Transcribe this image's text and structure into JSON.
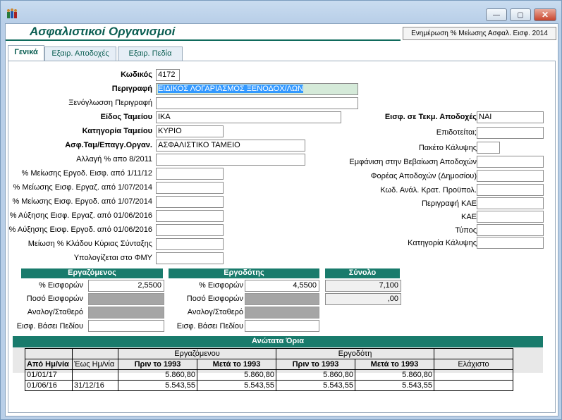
{
  "window": {
    "title_buttons": {
      "minimize": "—",
      "restore": "▢",
      "close": "✕"
    }
  },
  "header": {
    "title": "Ασφαλιστικοί Οργανισμοί",
    "update_label": "Ενημέρωση % Μείωσης  Ασφαλ. Εισφ. 2014"
  },
  "tabs": [
    {
      "label": "Γενικά"
    },
    {
      "label": "Εξαιρ. Αποδοχές"
    },
    {
      "label": "Εξαιρ. Πεδία"
    }
  ],
  "left": {
    "code": {
      "label": "Κωδικός",
      "value": "4172"
    },
    "description": {
      "label": "Περιγραφή",
      "value": "ΕΙΔΙΚΟΣ ΛΟΓΑΡΙΑΣΜΟΣ ΞΕΝΟΔΟΧ/ΛΩΝ"
    },
    "foreign_description": {
      "label": "Ξενόγλωσση Περιγραφή",
      "value": ""
    },
    "fund_type": {
      "label": "Είδος Ταμείου",
      "value": "ΙΚΑ"
    },
    "fund_category": {
      "label": "Κατηγορία Ταμείου",
      "value": "ΚΥΡΙΟ"
    },
    "insurance_org": {
      "label": "Ασφ.Ταμ/Επαγγ.Οργαν.",
      "value": "ΑΣΦΑΛΙΣΤΙΚΟ ΤΑΜΕΙΟ"
    },
    "change_pct": {
      "label": "Αλλαγή % απο 8/2011",
      "value": ""
    },
    "r1": {
      "label": "% Μείωσης Εργοδ. Εισφ. από 1/11/12",
      "value": ""
    },
    "r2": {
      "label": "% Μείωσης Εισφ. Εργαζ. από 1/07/2014",
      "value": ""
    },
    "r3": {
      "label": "% Μείωσης Εισφ. Εργοδ. από 1/07/2014",
      "value": ""
    },
    "r4": {
      "label": "% Αύξησης Εισφ. Εργαζ. από 01/06/2016",
      "value": ""
    },
    "r5": {
      "label": "% Αύξησης Εισφ. Εργοδ. από 01/06/2016",
      "value": ""
    },
    "r6": {
      "label": "Μείωση % Κλάδου Κύριας Σύνταξης",
      "value": ""
    },
    "r7": {
      "label": "Υπολογίζεται στο ΦΜΥ",
      "value": ""
    }
  },
  "right": {
    "f1": {
      "label": "Εισφ. σε Τεκμ. Αποδοχές",
      "value": "ΝΑΙ"
    },
    "f2": {
      "label": "Επιδοτείται;",
      "value": ""
    },
    "f3": {
      "label": "Πακέτο Κάλυψης",
      "value": ""
    },
    "f4": {
      "label": "Εμφάνιση στην Βεβαίωση Αποδοχών",
      "value": ""
    },
    "f5": {
      "label": "Φορέας Αποδοχών (Δημοσίου)",
      "value": ""
    },
    "f6": {
      "label": "Κωδ. Ανάλ. Κρατ. Προϋπολ.",
      "value": ""
    },
    "f7": {
      "label": "Περιγραφή ΚΑΕ",
      "value": ""
    },
    "f8": {
      "label": "ΚΑΕ",
      "value": ""
    },
    "f9": {
      "label": "Τύπος",
      "value": ""
    },
    "f10": {
      "label": "Κατηγορία Κάλυψης",
      "value": ""
    }
  },
  "contrib": {
    "employee": {
      "title": "Εργαζόμενος",
      "pct_label": "% Εισφορών",
      "pct": "2,5500",
      "amount_label": "Ποσό Εισφορών",
      "ratio_label": "Αναλογ/Σταθερό",
      "field_label": "Εισφ. Βάσει Πεδίου"
    },
    "employer": {
      "title": "Εργοδότης",
      "pct_label": "% Εισφορών",
      "pct": "4,5500",
      "amount_label": "Ποσό Εισφορών",
      "ratio_label": "Αναλογ/Σταθερό",
      "field_label": "Εισφ. Βάσει Πεδίου"
    },
    "total": {
      "title": "Σύνολο",
      "pct": "7,100",
      "amount": ",00"
    }
  },
  "limits": {
    "title": "Ανώτατα      Όρια",
    "group_employee": "Εργαζόμενου",
    "group_employer": "Εργοδότη",
    "headers": [
      "Από Ημ/νία",
      "Έως Ημ/νία",
      "Πριν το 1993",
      "Μετά το 1993",
      "Πριν το 1993",
      "Μετά το 1993",
      "Ελάχιστο"
    ],
    "rows": [
      [
        "01/01/17",
        "",
        "5.860,80",
        "5.860,80",
        "5.860,80",
        "5.860,80",
        ""
      ],
      [
        "01/06/16",
        "31/12/16",
        "5.543,55",
        "5.543,55",
        "5.543,55",
        "5.543,55",
        ""
      ]
    ]
  }
}
